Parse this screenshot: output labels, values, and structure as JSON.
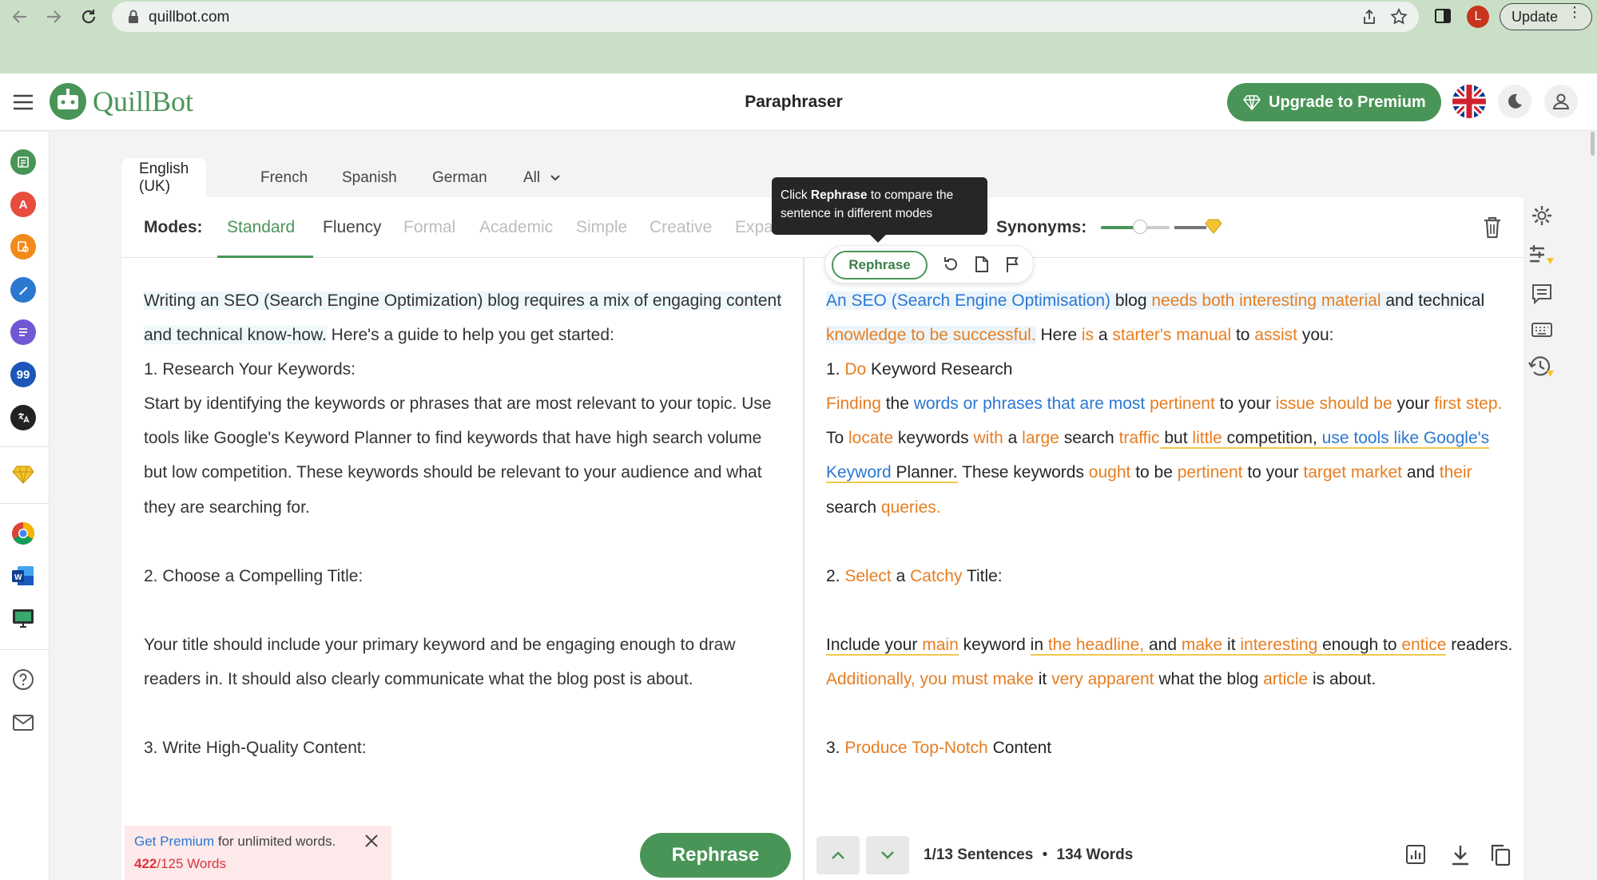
{
  "browser": {
    "url": "quillbot.com",
    "profile_initial": "L",
    "update_label": "Update"
  },
  "header": {
    "brand": "QuillBot",
    "title": "Paraphraser",
    "upgrade_label": "Upgrade to Premium"
  },
  "language_tabs": [
    "English (UK)",
    "French",
    "Spanish",
    "German",
    "All"
  ],
  "modes": {
    "label": "Modes:",
    "items": [
      "Standard",
      "Fluency",
      "Formal",
      "Academic",
      "Simple",
      "Creative",
      "Expa"
    ],
    "active": "Standard"
  },
  "synonyms": {
    "label": "Synonyms:",
    "level": 0.5
  },
  "tooltip": {
    "pre": "Click ",
    "bold": "Rephrase",
    "post": " to compare the sentence in different modes"
  },
  "mini_toolbar": {
    "rephrase_label": "Rephrase"
  },
  "input": {
    "lines": [
      "Writing an SEO (Search Engine Optimization) blog requires a mix of engaging content and technical know-how.",
      " Here's a guide to help you get started:",
      "1. Research Your Keywords:",
      "Start by identifying the keywords or phrases that are most relevant to your topic. Use tools like Google's Keyword Planner to find keywords that have high search volume but low competition. These keywords should be relevant to your audience and what they are searching for.",
      "2. Choose a Compelling Title:",
      "Your title should include your primary keyword and be engaging enough to draw readers in. It should also clearly communicate what the blog post is about.",
      "3. Write High-Quality Content:"
    ]
  },
  "output": {
    "p1": [
      "An SEO (Search Engine Optimisation)",
      " blog ",
      "needs both interesting material",
      " and technical ",
      "knowledge to be successful.",
      " Here ",
      "is",
      " a ",
      "starter's manual",
      " to ",
      "assist",
      " you:"
    ],
    "p2": [
      "1. ",
      "Do",
      " Keyword Research"
    ],
    "p3": [
      "Finding",
      " the ",
      "words or phrases that are most",
      " ",
      "pertinent",
      " to your ",
      "issue should be",
      " your ",
      "first step.",
      " To ",
      "locate",
      " keywords ",
      "with",
      " a ",
      "large",
      " search ",
      "traffic",
      " but ",
      "little",
      " competition, ",
      "use tools like Google's Keyword",
      " Planner.",
      " These keywords ",
      "ought",
      " to be ",
      "pertinent",
      " to your ",
      "target market",
      " and ",
      "their",
      " search ",
      "queries."
    ],
    "p4": [
      "2. ",
      "Select",
      " a ",
      "Catchy",
      " Title:"
    ],
    "p5": [
      "Include your ",
      "main",
      " keyword ",
      "in ",
      "the headline,",
      " and ",
      "make",
      " it ",
      "interesting",
      " enough to ",
      "entice",
      " readers. ",
      "Additionally, you must make",
      " it ",
      "very apparent",
      " what the blog ",
      "article",
      " is about."
    ],
    "p6": [
      "3. ",
      "Produce Top-Notch",
      " Content"
    ]
  },
  "footer": {
    "get_premium": "Get Premium",
    "unlimited": " for unlimited words.",
    "word_count": "422",
    "word_limit": "/125 Words",
    "rephrase_label": "Rephrase",
    "sentences": "1/13 Sentences",
    "bullet": "•",
    "words": "134 Words"
  },
  "colors": {
    "brand_green": "#499557",
    "changed_orange": "#e67e22",
    "structure_blue": "#2b78d1",
    "underline_yellow": "#f2c84b"
  },
  "icons": [
    "back-icon",
    "forward-icon",
    "reload-icon",
    "lock-icon",
    "share-icon",
    "star-icon",
    "sidebar-icon",
    "menu-dots-icon",
    "hamburger-icon",
    "diamond-icon",
    "flag-uk-icon",
    "moon-icon",
    "user-icon",
    "trash-icon",
    "undo-icon",
    "copy-doc-icon",
    "flag-icon",
    "gear-icon",
    "stats-icon",
    "download-icon",
    "copy-icon",
    "chevron-up-icon",
    "chevron-down-icon",
    "close-icon"
  ]
}
